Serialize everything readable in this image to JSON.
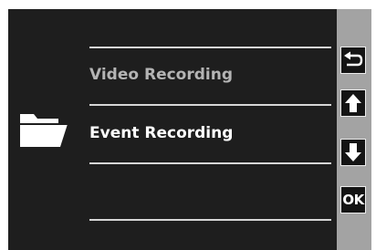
{
  "menu": {
    "items": [
      {
        "label": "Video Recording",
        "selected": false
      },
      {
        "label": "Event Recording",
        "selected": true
      }
    ]
  },
  "sidebar": {
    "buttons": [
      {
        "icon": "back-arrow-icon"
      },
      {
        "icon": "arrow-up-icon"
      },
      {
        "icon": "arrow-down-icon"
      },
      {
        "label": "OK"
      }
    ]
  },
  "colors": {
    "background": "#1e1e1e",
    "sidebar": "#a3a3a3",
    "item_text": "#b4b4b4",
    "selected_text": "#ffffff",
    "divider": "#d6d6d6"
  }
}
